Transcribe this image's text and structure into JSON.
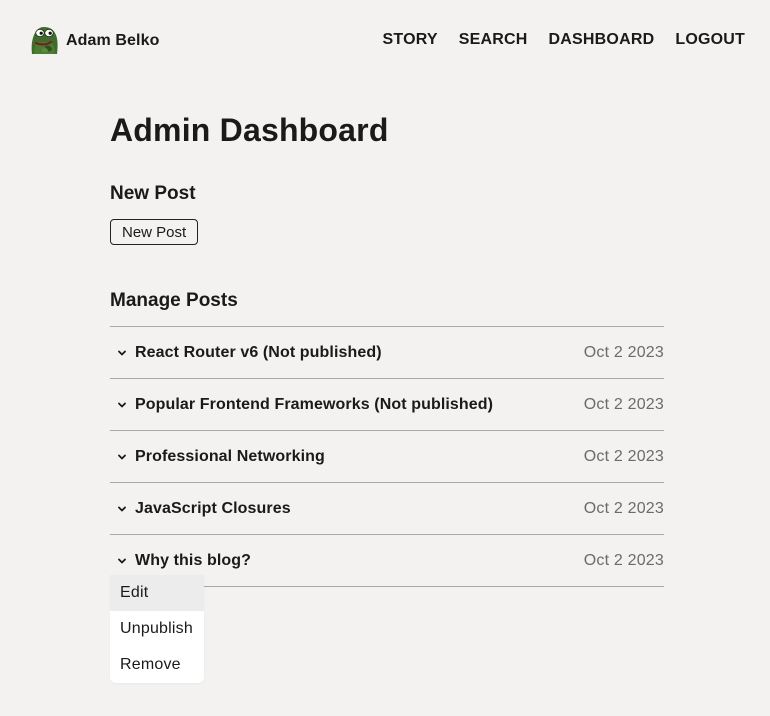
{
  "header": {
    "brand_name": "Adam Belko",
    "nav": [
      "STORY",
      "SEARCH",
      "DASHBOARD",
      "LOGOUT"
    ]
  },
  "page": {
    "title": "Admin Dashboard",
    "new_post_heading": "New Post",
    "new_post_button": "New Post",
    "manage_heading": "Manage Posts"
  },
  "posts": [
    {
      "title": "React Router v6 (Not published)",
      "date": "Oct 2 2023"
    },
    {
      "title": "Popular Frontend Frameworks (Not published)",
      "date": "Oct 2 2023"
    },
    {
      "title": "Professional Networking",
      "date": "Oct 2 2023"
    },
    {
      "title": "JavaScript Closures",
      "date": "Oct 2 2023"
    },
    {
      "title": "Why this blog?",
      "date": "Oct 2 2023"
    }
  ],
  "context_menu": {
    "items": [
      "Edit",
      "Unpublish",
      "Remove"
    ],
    "highlighted": "Edit"
  },
  "icons": {
    "avatar": "frog-avatar-icon",
    "row_toggle": "chevron-down-icon"
  },
  "colors": {
    "background": "#f3f2f0",
    "text": "#1a1a1a",
    "date_text": "#6b6b6b",
    "divider": "#a8a8a8",
    "menu_bg": "#ffffff",
    "menu_highlight": "#ececec"
  }
}
